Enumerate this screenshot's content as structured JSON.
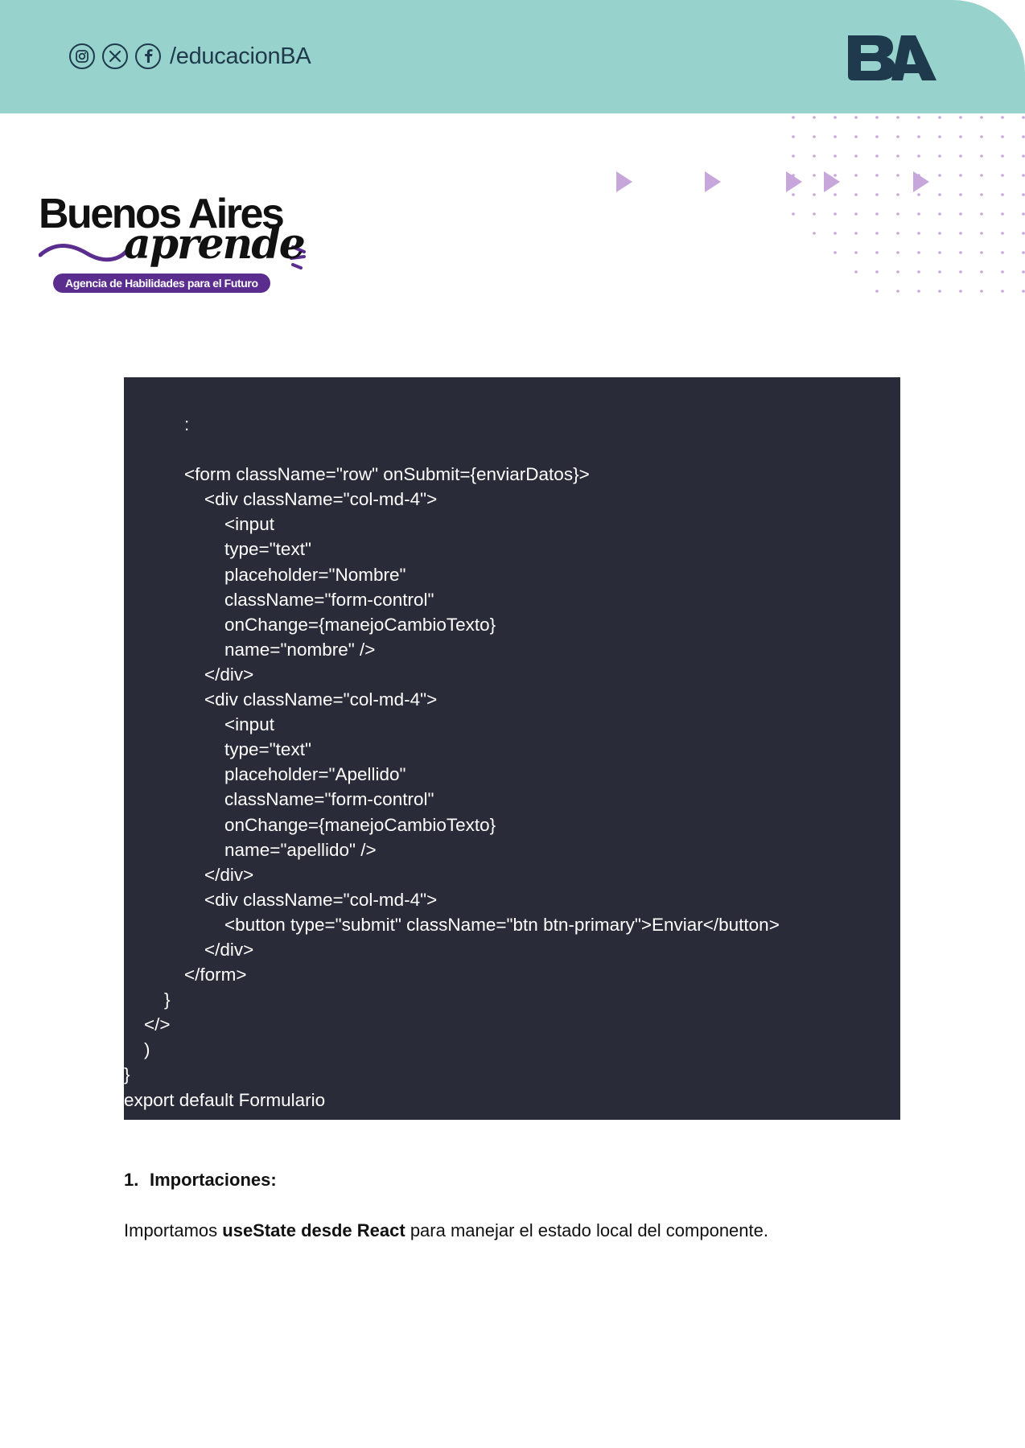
{
  "header": {
    "social_icons": [
      "instagram-icon",
      "x-twitter-icon",
      "facebook-icon"
    ],
    "handle": "/educacionBA",
    "logo_text": "BA",
    "band_color": "#97d3cc",
    "logo_color": "#1e3a4c"
  },
  "brand": {
    "title": "Buenos Aires",
    "subtitle": "aprende",
    "tagline": "Agencia de Habilidades para el Futuro",
    "accent_color": "#5b2d8e"
  },
  "decor": {
    "dot_color": "#c7a6dc",
    "arrow_color": "#c7a6dc"
  },
  "code": {
    "background": "#2a2b38",
    "lines": [
      "            :",
      "",
      "            <form className=\"row\" onSubmit={enviarDatos}>",
      "                <div className=\"col-md-4\">",
      "                    <input",
      "                    type=\"text\"",
      "                    placeholder=\"Nombre\"",
      "                    className=\"form-control\"",
      "                    onChange={manejoCambioTexto}",
      "                    name=\"nombre\" />",
      "                </div>",
      "                <div className=\"col-md-4\">",
      "                    <input",
      "                    type=\"text\"",
      "                    placeholder=\"Apellido\"",
      "                    className=\"form-control\"",
      "                    onChange={manejoCambioTexto}",
      "                    name=\"apellido\" />",
      "                </div>",
      "                <div className=\"col-md-4\">",
      "                    <button type=\"submit\" className=\"btn btn-primary\">Enviar</button>",
      "                </div>",
      "            </form>",
      "        }",
      "    </>",
      "    )",
      "}",
      "export default Formulario"
    ]
  },
  "section": {
    "number": "1.",
    "title": "Importaciones:",
    "body_prefix": "Importamos ",
    "body_bold": "useState desde React",
    "body_suffix": " para manejar el estado local del componente."
  }
}
